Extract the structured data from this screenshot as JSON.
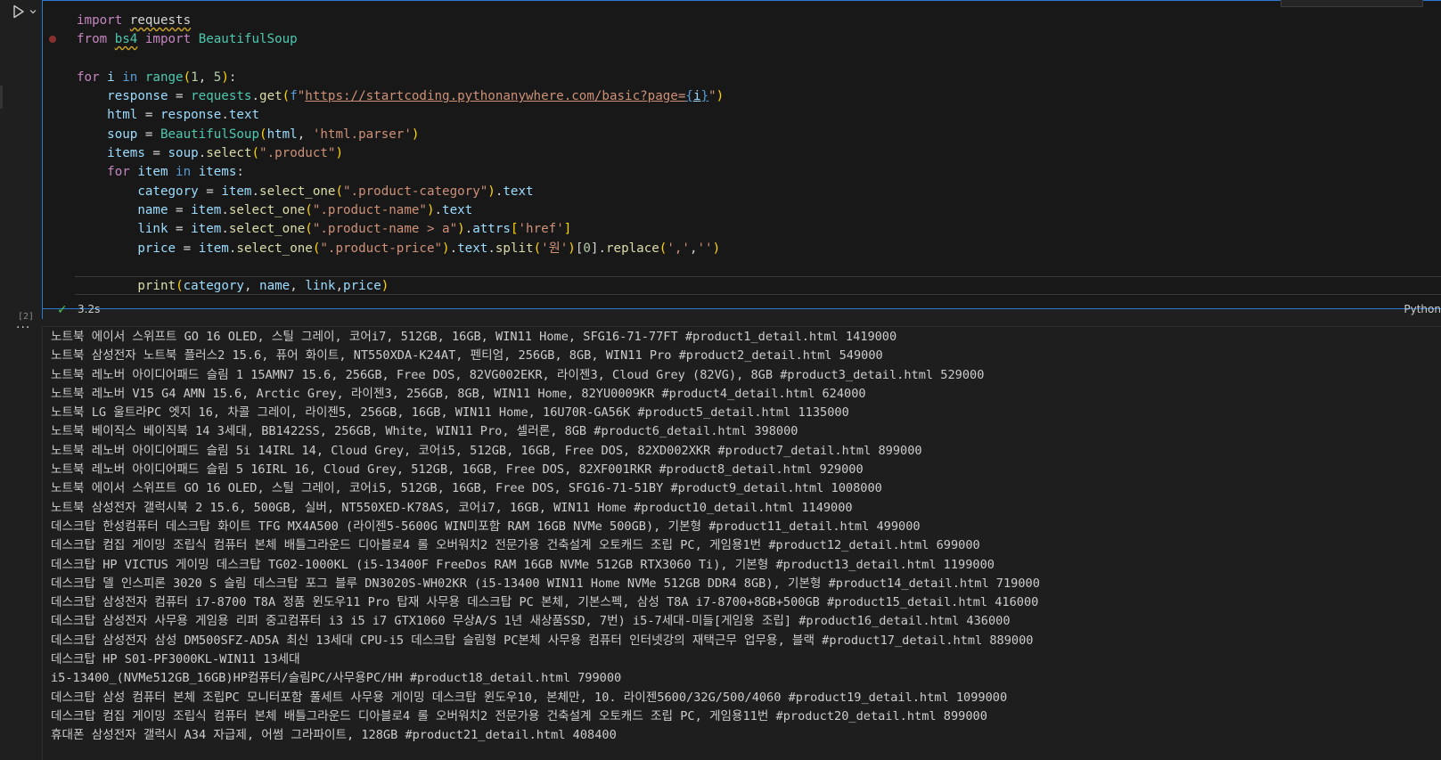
{
  "cell": {
    "execution_count": "[2]",
    "duration": "3.2s",
    "language": "Python",
    "code_lines": [
      [
        {
          "t": "import ",
          "c": "kw"
        },
        {
          "t": "requests",
          "c": "squig"
        }
      ],
      [
        {
          "t": "from ",
          "c": "kw"
        },
        {
          "t": "bs4",
          "c": "cls squig"
        },
        {
          "t": " import ",
          "c": "kw"
        },
        {
          "t": "BeautifulSoup",
          "c": "cls"
        }
      ],
      [],
      [
        {
          "t": "for ",
          "c": "kw"
        },
        {
          "t": "i",
          "c": "var"
        },
        {
          "t": " in ",
          "c": "kwb"
        },
        {
          "t": "range",
          "c": "cls"
        },
        {
          "t": "(",
          "c": "brk"
        },
        {
          "t": "1",
          "c": "num"
        },
        {
          "t": ", "
        },
        {
          "t": "5",
          "c": "num"
        },
        {
          "t": ")",
          "c": "brk"
        },
        {
          "t": ":"
        }
      ],
      [
        {
          "t": "    "
        },
        {
          "t": "response",
          "c": "var"
        },
        {
          "t": " = "
        },
        {
          "t": "requests",
          "c": "cls"
        },
        {
          "t": "."
        },
        {
          "t": "get",
          "c": "fn"
        },
        {
          "t": "(",
          "c": "brk"
        },
        {
          "t": "f",
          "c": "kwb"
        },
        {
          "t": "\"",
          "c": "str"
        },
        {
          "t": "https://startcoding.pythonanywhere.com/basic?page=",
          "c": "str link"
        },
        {
          "t": "{",
          "c": "kwb link"
        },
        {
          "t": "i",
          "c": "var link"
        },
        {
          "t": "}",
          "c": "kwb link"
        },
        {
          "t": "\"",
          "c": "str"
        },
        {
          "t": ")",
          "c": "brk"
        }
      ],
      [
        {
          "t": "    "
        },
        {
          "t": "html",
          "c": "var"
        },
        {
          "t": " = "
        },
        {
          "t": "response",
          "c": "var"
        },
        {
          "t": "."
        },
        {
          "t": "text",
          "c": "var"
        }
      ],
      [
        {
          "t": "    "
        },
        {
          "t": "soup",
          "c": "var"
        },
        {
          "t": " = "
        },
        {
          "t": "BeautifulSoup",
          "c": "cls"
        },
        {
          "t": "(",
          "c": "brk"
        },
        {
          "t": "html",
          "c": "var"
        },
        {
          "t": ", "
        },
        {
          "t": "'html.parser'",
          "c": "str"
        },
        {
          "t": ")",
          "c": "brk"
        }
      ],
      [
        {
          "t": "    "
        },
        {
          "t": "items",
          "c": "var"
        },
        {
          "t": " = "
        },
        {
          "t": "soup",
          "c": "var"
        },
        {
          "t": "."
        },
        {
          "t": "select",
          "c": "fn"
        },
        {
          "t": "(",
          "c": "brk"
        },
        {
          "t": "\".product\"",
          "c": "str"
        },
        {
          "t": ")",
          "c": "brk"
        }
      ],
      [
        {
          "t": "    "
        },
        {
          "t": "for ",
          "c": "kw"
        },
        {
          "t": "item",
          "c": "var"
        },
        {
          "t": " in ",
          "c": "kwb"
        },
        {
          "t": "items",
          "c": "var"
        },
        {
          "t": ":"
        }
      ],
      [
        {
          "t": "        "
        },
        {
          "t": "category",
          "c": "var"
        },
        {
          "t": " = "
        },
        {
          "t": "item",
          "c": "var"
        },
        {
          "t": "."
        },
        {
          "t": "select_one",
          "c": "fn"
        },
        {
          "t": "(",
          "c": "brk"
        },
        {
          "t": "\".product-category\"",
          "c": "str"
        },
        {
          "t": ")",
          "c": "brk"
        },
        {
          "t": "."
        },
        {
          "t": "text",
          "c": "var"
        }
      ],
      [
        {
          "t": "        "
        },
        {
          "t": "name",
          "c": "var"
        },
        {
          "t": " = "
        },
        {
          "t": "item",
          "c": "var"
        },
        {
          "t": "."
        },
        {
          "t": "select_one",
          "c": "fn"
        },
        {
          "t": "(",
          "c": "brk"
        },
        {
          "t": "\".product-name\"",
          "c": "str"
        },
        {
          "t": ")",
          "c": "brk"
        },
        {
          "t": "."
        },
        {
          "t": "text",
          "c": "var"
        }
      ],
      [
        {
          "t": "        "
        },
        {
          "t": "link",
          "c": "var"
        },
        {
          "t": " = "
        },
        {
          "t": "item",
          "c": "var"
        },
        {
          "t": "."
        },
        {
          "t": "select_one",
          "c": "fn"
        },
        {
          "t": "(",
          "c": "brk"
        },
        {
          "t": "\".product-name > a\"",
          "c": "str"
        },
        {
          "t": ")",
          "c": "brk"
        },
        {
          "t": "."
        },
        {
          "t": "attrs",
          "c": "var"
        },
        {
          "t": "[",
          "c": "brk"
        },
        {
          "t": "'href'",
          "c": "str"
        },
        {
          "t": "]",
          "c": "brk"
        }
      ],
      [
        {
          "t": "        "
        },
        {
          "t": "price",
          "c": "var"
        },
        {
          "t": " = "
        },
        {
          "t": "item",
          "c": "var"
        },
        {
          "t": "."
        },
        {
          "t": "select_one",
          "c": "fn"
        },
        {
          "t": "(",
          "c": "brk"
        },
        {
          "t": "\".product-price\"",
          "c": "str"
        },
        {
          "t": ")",
          "c": "brk"
        },
        {
          "t": "."
        },
        {
          "t": "text",
          "c": "var"
        },
        {
          "t": "."
        },
        {
          "t": "split",
          "c": "fn"
        },
        {
          "t": "(",
          "c": "brk"
        },
        {
          "t": "'원'",
          "c": "str"
        },
        {
          "t": ")",
          "c": "brk"
        },
        {
          "t": "["
        },
        {
          "t": "0",
          "c": "num"
        },
        {
          "t": "]."
        },
        {
          "t": "replace",
          "c": "fn"
        },
        {
          "t": "(",
          "c": "brk"
        },
        {
          "t": "','",
          "c": "str"
        },
        {
          "t": ","
        },
        {
          "t": "''",
          "c": "str"
        },
        {
          "t": ")",
          "c": "brk"
        }
      ],
      [],
      [
        {
          "t": "        "
        },
        {
          "t": "print",
          "c": "fn"
        },
        {
          "t": "(",
          "c": "brk"
        },
        {
          "t": "category",
          "c": "var"
        },
        {
          "t": ", "
        },
        {
          "t": "name",
          "c": "var"
        },
        {
          "t": ", "
        },
        {
          "t": "link",
          "c": "var"
        },
        {
          "t": ","
        },
        {
          "t": "price",
          "c": "var"
        },
        {
          "t": ")",
          "c": "brk"
        }
      ]
    ]
  },
  "output": {
    "more_label": "···",
    "lines": [
      "노트북 에이서 스위프트 GO 16 OLED, 스틸 그레이, 코어i7, 512GB, 16GB, WIN11 Home, SFG16-71-77FT #product1_detail.html 1419000",
      "노트북 삼성전자 노트북 플러스2 15.6, 퓨어 화이트, NT550XDA-K24AT, 펜티엄, 256GB, 8GB, WIN11 Pro #product2_detail.html 549000",
      "노트북 레노버 아이디어패드 슬림 1 15AMN7 15.6, 256GB, Free DOS, 82VG002EKR, 라이젠3, Cloud Grey (82VG), 8GB #product3_detail.html 529000",
      "노트북 레노버 V15 G4 AMN 15.6, Arctic Grey, 라이젠3, 256GB, 8GB, WIN11 Home, 82YU0009KR #product4_detail.html 624000",
      "노트북 LG 울트라PC 엣지 16, 차콜 그레이, 라이젠5, 256GB, 16GB, WIN11 Home, 16U70R-GA56K #product5_detail.html 1135000",
      "노트북 베이직스 베이직북 14 3세대, BB1422SS, 256GB, White, WIN11 Pro, 셀러론, 8GB #product6_detail.html 398000",
      "노트북 레노버 아이디어패드 슬림 5i 14IRL 14, Cloud Grey, 코어i5, 512GB, 16GB, Free DOS, 82XD002XKR #product7_detail.html 899000",
      "노트북 레노버 아이디어패드 슬림 5 16IRL 16, Cloud Grey, 512GB, 16GB, Free DOS, 82XF001RKR #product8_detail.html 929000",
      "노트북 에이서 스위프트 GO 16 OLED, 스틸 그레이, 코어i5, 512GB, 16GB, Free DOS, SFG16-71-51BY #product9_detail.html 1008000",
      "노트북 삼성전자 갤럭시북 2 15.6, 500GB, 실버, NT550XED-K78AS, 코어i7, 16GB, WIN11 Home #product10_detail.html 1149000",
      "데스크탑 한성컴퓨터 데스크탑 화이트 TFG MX4A500 (라이젠5-5600G WIN미포함 RAM 16GB NVMe 500GB), 기본형 #product11_detail.html 499000",
      "데스크탑 컴집 게이밍 조립식 컴퓨터 본체 배틀그라운드 디아블로4 롤 오버워치2 전문가용 건축설계 오토캐드 조립 PC, 게임용1번 #product12_detail.html 699000",
      "데스크탑 HP VICTUS 게이밍 데스크탑 TG02-1000KL (i5-13400F FreeDos RAM 16GB NVMe 512GB RTX3060 Ti), 기본형 #product13_detail.html 1199000",
      "데스크탑 델 인스피론 3020 S 슬림 데스크탑 포그 블루 DN3020S-WH02KR (i5-13400 WIN11 Home NVMe 512GB DDR4 8GB), 기본형 #product14_detail.html 719000",
      "데스크탑 삼성전자 컴퓨터 i7-8700 T8A 정품 윈도우11 Pro 탑재 사무용 데스크탑 PC 본체, 기본스펙, 삼성 T8A i7-8700+8GB+500GB #product15_detail.html 416000",
      "데스크탑 삼성전자 사무용 게임용 리퍼 중고컴퓨터 i3 i5 i7 GTX1060 무상A/S 1년 새상품SSD, 7번) i5-7세대-미들[게임용 조립] #product16_detail.html 436000",
      "데스크탑 삼성전자 삼성 DM500SFZ-AD5A 최신 13세대 CPU-i5 데스크탑 슬림형 PC본체 사무용 컴퓨터 인터넷강의 재택근무 업무용, 블랙 #product17_detail.html 889000",
      "데스크탑 HP S01-PF3000KL-WIN11 13세대",
      "i5-13400_(NVMe512GB_16GB)HP컴퓨터/슬림PC/사무용PC/HH #product18_detail.html 799000",
      "데스크탑 삼성 컴퓨터 본체 조립PC 모니터포함 풀세트 사무용 게이밍 데스크탑 윈도우10, 본체만, 10. 라이젠5600/32G/500/4060 #product19_detail.html 1099000",
      "데스크탑 컴집 게이밍 조립식 컴퓨터 본체 배틀그라운드 디아블로4 롤 오버워치2 전문가용 건축설계 오토캐드 조립 PC, 게임용11번 #product20_detail.html 899000",
      "휴대폰 삼성전자 갤럭시 A34 자급제, 어썸 그라파이트, 128GB #product21_detail.html 408400"
    ]
  },
  "colors": {
    "accent": "#2b79d3",
    "success": "#4ec04e"
  },
  "icons": {
    "run": "play-icon",
    "dropdown": "chevron-down-icon",
    "status": "check-icon",
    "more": "ellipsis-icon"
  }
}
